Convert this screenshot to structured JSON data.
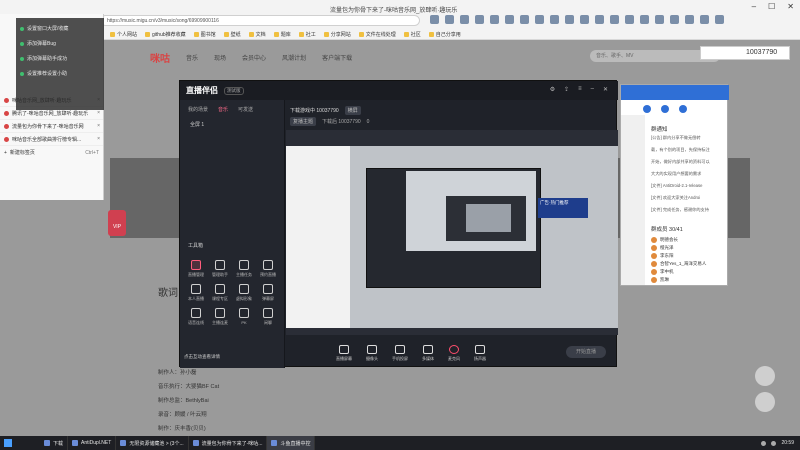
{
  "browser": {
    "window_title": "流量包为你骨下来了-咪咕音乐网_放肆听·趣玩乐",
    "address": "https://music.migu.cn/v3/music/song/69909900116",
    "extension_count": 20,
    "bookmarks": [
      "个人网站",
      "github推荐收藏",
      "图书馆",
      "壁纸",
      "文档",
      "题库",
      "社工",
      "分享网站",
      "文件在线处理",
      "社区",
      "自己分享用"
    ]
  },
  "tabs": {
    "items": [
      "设置窗口大屏/收藏",
      "添加弹幕Bug",
      "添加弹幕助手成功",
      "设置推荐设置小助",
      "咪咕音乐网_放肆听·趣玩乐",
      "腾讯了-咪咕音乐网_放肆听·趣玩乐",
      "流量包为你骨下来了-咪咕音乐网",
      "咪咕音乐全部歌曲排行榜专辑..."
    ],
    "new_tab_label": "新建标签页",
    "new_tab_shortcut": "Ctrl+T"
  },
  "site": {
    "logo": "咪咕",
    "nav": [
      "音乐",
      "现场",
      "会员中心",
      "风潮计划",
      "客户端下载"
    ],
    "search_placeholder": "音乐、歌手、MV",
    "lyric_title": "歌词",
    "credits": [
      "制作人：孙小磊",
      "音乐执行：大婴猫BF Cat",
      "制作总监：BethlyBai",
      "录音：顾媛 / 叶云翔",
      "制作：庆丰香(贝贝)"
    ],
    "vip_label": "VIP"
  },
  "live_app": {
    "name": "直播伴侣",
    "badge": "测试版",
    "left_tabs": [
      "我的场景",
      "音乐",
      "可发送"
    ],
    "scene_label": "全屏 1",
    "tools_label": "工具箱",
    "tools": [
      "直播管理",
      "管理助手",
      "主播任务",
      "预约直播",
      "本人直播",
      "课程专区",
      "虚拟形象",
      "弹幕屏",
      "语音连线",
      "主播连麦",
      "PK",
      "闲聊"
    ],
    "warning": "点击互动查看详情",
    "room_title": "下载游戏中 10037790",
    "room_badge": "横屏",
    "activity": "复播主题",
    "viewer_label": "下载后 10037790",
    "viewer_count": "0",
    "overlay_tag": "广告·热门推荐",
    "bottom_tools": [
      "直播屏幕",
      "摄像头",
      "手机投屏",
      "多媒体",
      "麦克风",
      "扬声器"
    ],
    "start_button": "开始直播"
  },
  "chat": {
    "notice_title": "群通知",
    "notice_lines": [
      "[公告] 群内分享不做无偿转",
      "载，有个别的项目，先保持标注",
      "开始，做好内部共享的资料可以",
      "大大的实现用户想要的需求",
      "[文件] AntiDroid-2.1-release",
      "[文件] 欢迎大家关注Androi",
      "[文件] 完成任务，感谢你的支持"
    ],
    "members_title": "群成员 30/41",
    "members": [
      "明德会长",
      "橙光泽",
      "李东阳",
      "合智Yes_1_海洋交易人",
      "李中机",
      "凯琳"
    ],
    "floating_counter": "10037790"
  },
  "taskbar": {
    "items": [
      "下载",
      "AntiDupl.NET",
      "无限资源储藏池 > (3个...",
      "流量包为你骨下来了-咪咕...",
      "斗鱼直播中控"
    ],
    "active_index": 4,
    "clock": "20:59"
  }
}
